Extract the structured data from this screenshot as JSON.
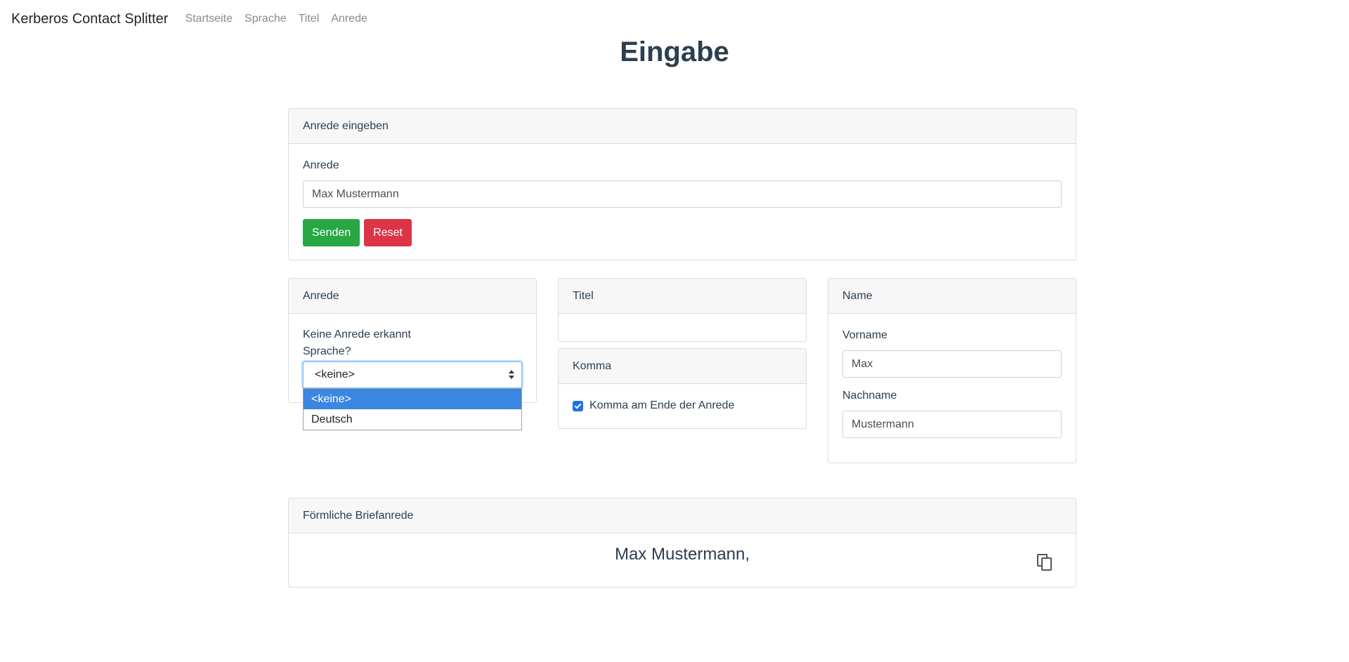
{
  "navbar": {
    "brand": "Kerberos Contact Splitter",
    "links": [
      "Startseite",
      "Sprache",
      "Titel",
      "Anrede"
    ]
  },
  "page_title": "Eingabe",
  "input_card": {
    "header": "Anrede eingeben",
    "field_label": "Anrede",
    "field_value": "Max Mustermann",
    "submit_label": "Senden",
    "reset_label": "Reset"
  },
  "anrede_card": {
    "header": "Anrede",
    "status": "Keine Anrede erkannt",
    "language_question": "Sprache?",
    "selected_language": "<keine>",
    "language_options": [
      "<keine>",
      "Deutsch"
    ]
  },
  "titel_card": {
    "header": "Titel"
  },
  "komma_card": {
    "header": "Komma",
    "checkbox_label": "Komma am Ende der Anrede",
    "checked": true
  },
  "name_card": {
    "header": "Name",
    "first_name_label": "Vorname",
    "first_name_value": "Max",
    "last_name_label": "Nachname",
    "last_name_value": "Mustermann"
  },
  "salutation_card": {
    "header": "Förmliche Briefanrede",
    "result": "Max Mustermann,"
  },
  "colors": {
    "success": "#28a745",
    "danger": "#dc3545",
    "accent": "#1a73e8",
    "text": "#2c3e50"
  },
  "icons": {
    "copy": "copy-icon",
    "select_arrows": "chevron-updown-icon",
    "checkbox": "check-icon"
  }
}
